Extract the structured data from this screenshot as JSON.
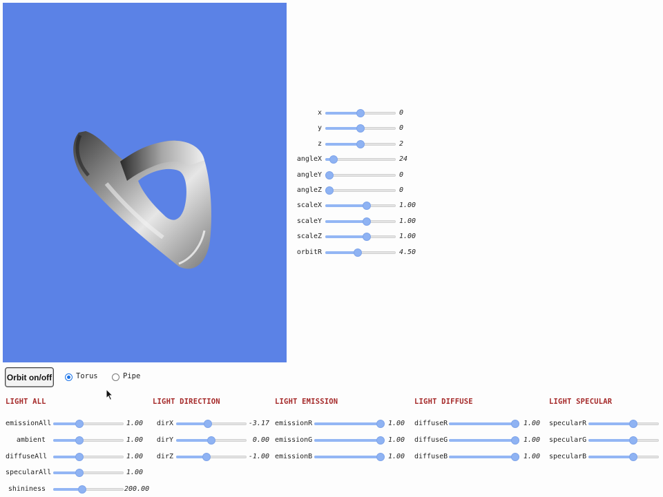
{
  "transform_controls": [
    {
      "name": "x",
      "label": "x",
      "value": "0",
      "level": 0.5
    },
    {
      "name": "y",
      "label": "y",
      "value": "0",
      "level": 0.5
    },
    {
      "name": "z",
      "label": "z",
      "value": "2",
      "level": 0.5
    },
    {
      "name": "anglex",
      "label": "angleX",
      "value": "24",
      "level": 0.07
    },
    {
      "name": "angley",
      "label": "angleY",
      "value": "0",
      "level": 0.0
    },
    {
      "name": "anglez",
      "label": "angleZ",
      "value": "0",
      "level": 0.0
    },
    {
      "name": "scalex",
      "label": "scaleX",
      "value": "1.00",
      "level": 0.6
    },
    {
      "name": "scaley",
      "label": "scaleY",
      "value": "1.00",
      "level": 0.6
    },
    {
      "name": "scalez",
      "label": "scaleZ",
      "value": "1.00",
      "level": 0.6
    },
    {
      "name": "orbitr",
      "label": "orbitR",
      "value": "4.50",
      "level": 0.45
    }
  ],
  "orbit_button": {
    "label": "Orbit on/off"
  },
  "shape_options": [
    {
      "name": "torus",
      "label": "Torus",
      "checked": true
    },
    {
      "name": "pipe",
      "label": "Pipe",
      "checked": false
    }
  ],
  "groups": [
    {
      "name": "light-all",
      "title": "LIGHT ALL",
      "controls": [
        {
          "name": "emissionall",
          "label": "emissionAll",
          "value": "1.00",
          "level": 0.35
        },
        {
          "name": "ambient",
          "label": "ambient",
          "value": "1.00",
          "level": 0.35
        },
        {
          "name": "diffuseall",
          "label": "diffuseAll",
          "value": "1.00",
          "level": 0.35
        },
        {
          "name": "specularall",
          "label": "specularAll",
          "value": "1.00",
          "level": 0.35
        },
        {
          "name": "shininess",
          "label": "shininess",
          "value": "200.00",
          "level": 0.4
        }
      ]
    },
    {
      "name": "light-direction",
      "title": "LIGHT DIRECTION",
      "controls": [
        {
          "name": "dirx",
          "label": "dirX",
          "value": "-3.17",
          "level": 0.44
        },
        {
          "name": "diry",
          "label": "dirY",
          "value": "0.00",
          "level": 0.5
        },
        {
          "name": "dirz",
          "label": "dirZ",
          "value": "-1.00",
          "level": 0.42
        }
      ]
    },
    {
      "name": "light-emission",
      "title": "LIGHT EMISSION",
      "controls": [
        {
          "name": "emissionr",
          "label": "emissionR",
          "value": "1.00",
          "level": 1.0
        },
        {
          "name": "emissiong",
          "label": "emissionG",
          "value": "1.00",
          "level": 1.0
        },
        {
          "name": "emissionb",
          "label": "emissionB",
          "value": "1.00",
          "level": 1.0
        }
      ]
    },
    {
      "name": "light-diffuse",
      "title": "LIGHT DIFFUSE",
      "controls": [
        {
          "name": "diffuser",
          "label": "diffuseR",
          "value": "1.00",
          "level": 1.0
        },
        {
          "name": "diffuseg",
          "label": "diffuseG",
          "value": "1.00",
          "level": 1.0
        },
        {
          "name": "diffuseb",
          "label": "diffuseB",
          "value": "1.00",
          "level": 1.0
        }
      ]
    },
    {
      "name": "light-specular",
      "title": "LIGHT SPECULAR",
      "controls": [
        {
          "name": "specularr",
          "label": "specularR",
          "value": "",
          "level": 0.65
        },
        {
          "name": "specularg",
          "label": "specularG",
          "value": "",
          "level": 0.65
        },
        {
          "name": "specularb",
          "label": "specularB",
          "value": "",
          "level": 0.65
        }
      ]
    }
  ],
  "colors": {
    "viewport_bg": "#5b82e6",
    "heading": "#a52a2a",
    "slider": "#8fb3f3"
  }
}
